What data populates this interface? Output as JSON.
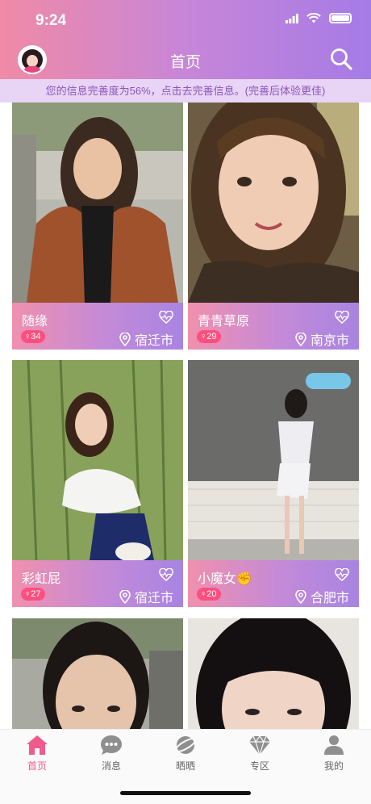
{
  "status_bar": {
    "time": "9:24"
  },
  "nav": {
    "title": "首页"
  },
  "banner": {
    "text": "您的信息完善度为56%，点击去完善信息。(完善后体验更佳)"
  },
  "cards": [
    {
      "name": "随缘",
      "age": "34",
      "city": "宿迁市"
    },
    {
      "name": "青青草原",
      "age": "29",
      "city": "南京市"
    },
    {
      "name": "彩虹屁",
      "age": "27",
      "city": "宿迁市"
    },
    {
      "name": "小魔女✊",
      "age": "20",
      "city": "合肥市"
    }
  ],
  "tabs": [
    {
      "label": "首页",
      "icon": "home-icon",
      "active": true
    },
    {
      "label": "消息",
      "icon": "chat-icon",
      "active": false
    },
    {
      "label": "晒晒",
      "icon": "planet-icon",
      "active": false
    },
    {
      "label": "专区",
      "icon": "diamond-icon",
      "active": false
    },
    {
      "label": "我的",
      "icon": "person-icon",
      "active": false
    }
  ],
  "colors": {
    "accent": "#f05a8c",
    "header_start": "#f08aa6",
    "header_end": "#a57be6",
    "banner_bg": "#e8d4f5"
  }
}
